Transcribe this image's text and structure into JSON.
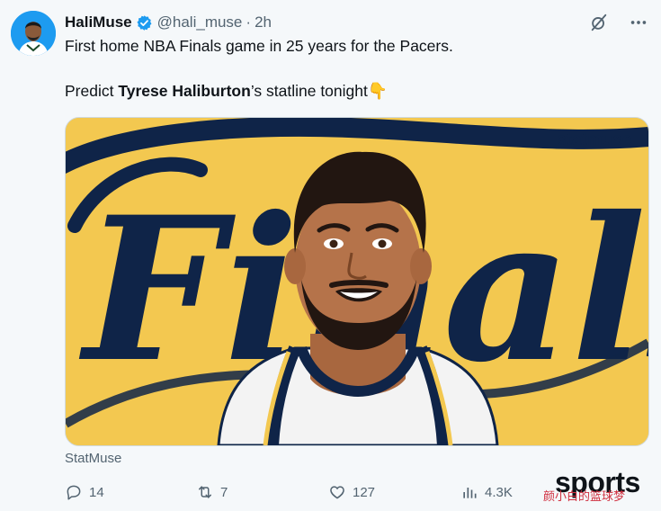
{
  "user": {
    "display_name": "HaliMuse",
    "handle": "@hali_muse",
    "separator": "·",
    "time": "2h",
    "verified_color": "#1d9bf0"
  },
  "tweet": {
    "line1": "First home NBA Finals game in 25 years for the Pacers.",
    "line2_prefix": "Predict ",
    "line2_name": "Tyrese Haliburton",
    "line2_suffix": "’s statline tonight",
    "emoji": "👇"
  },
  "media": {
    "banner_word": "Finals",
    "brand": "statmuse",
    "background_color": "#f3c850",
    "script_color": "#0f2448"
  },
  "source": "StatMuse",
  "actions": {
    "replies": "14",
    "reposts": "7",
    "likes": "127",
    "views": "4.3K"
  },
  "icons": {
    "grok": "grok-icon",
    "more": "more-icon",
    "reply": "reply-icon",
    "repost": "repost-icon",
    "like": "like-icon",
    "views": "views-icon"
  },
  "watermark": {
    "main": "sports",
    "sub": "颜小白的篮球梦"
  }
}
